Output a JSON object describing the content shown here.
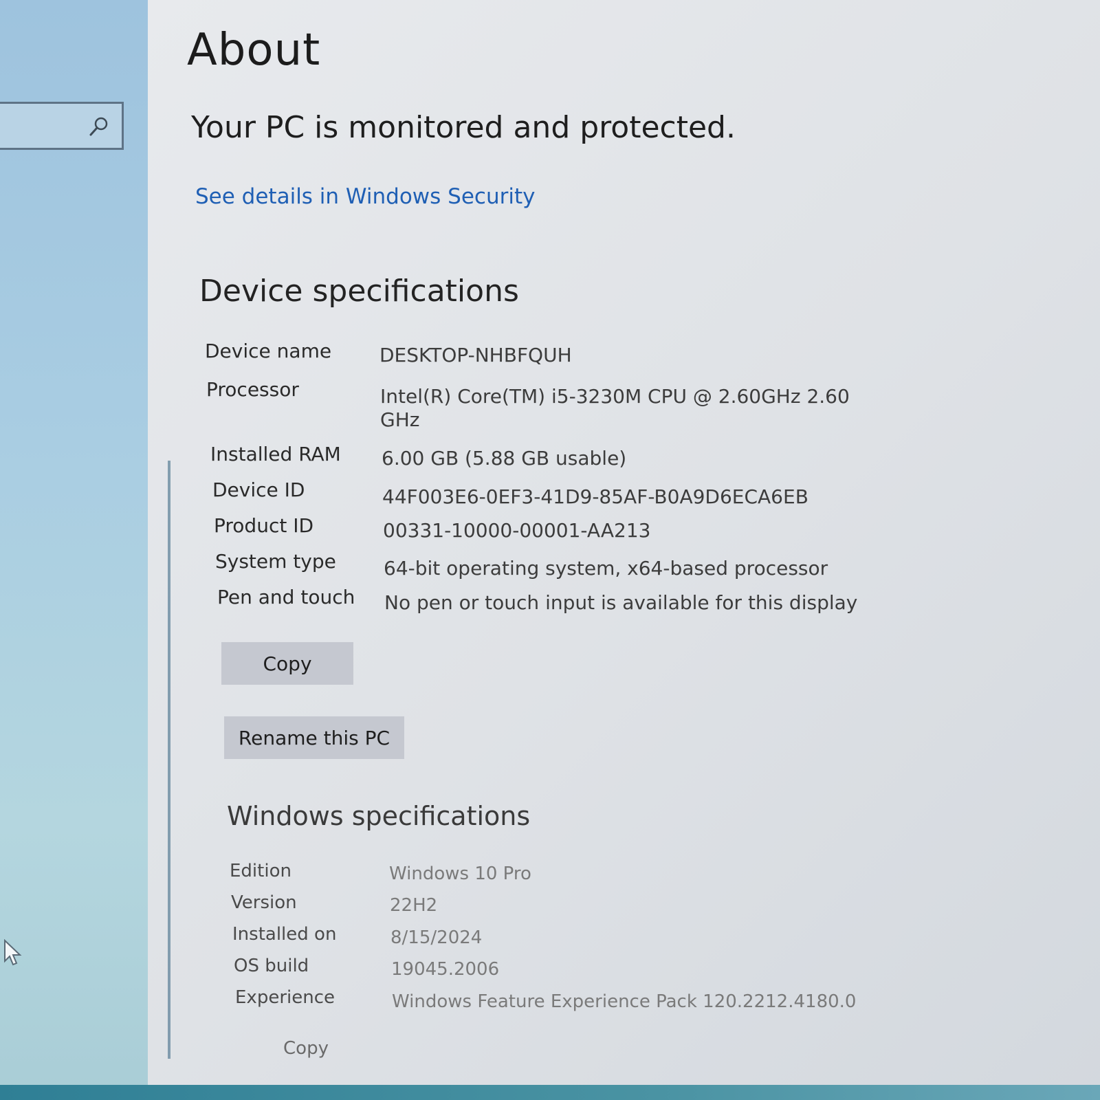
{
  "header": {
    "title": "About"
  },
  "security": {
    "status": "Your PC is monitored and protected.",
    "link": "See details in Windows Security"
  },
  "device_specs": {
    "title": "Device specifications",
    "rows": [
      {
        "label": "Device name",
        "value": "DESKTOP-NHBFQUH"
      },
      {
        "label": "Processor",
        "value": "Intel(R) Core(TM) i5-3230M CPU @ 2.60GHz   2.60 GHz"
      },
      {
        "label": "Installed RAM",
        "value": "6.00 GB (5.88 GB usable)"
      },
      {
        "label": "Device ID",
        "value": "44F003E6-0EF3-41D9-85AF-B0A9D6ECA6EB"
      },
      {
        "label": "Product ID",
        "value": "00331-10000-00001-AA213"
      },
      {
        "label": "System type",
        "value": "64-bit operating system, x64-based processor"
      },
      {
        "label": "Pen and touch",
        "value": "No pen or touch input is available for this display"
      }
    ],
    "copy_label": "Copy",
    "rename_label": "Rename this PC"
  },
  "windows_specs": {
    "title": "Windows specifications",
    "rows": [
      {
        "label": "Edition",
        "value": "Windows 10 Pro"
      },
      {
        "label": "Version",
        "value": "22H2"
      },
      {
        "label": "Installed on",
        "value": "8/15/2024"
      },
      {
        "label": "OS build",
        "value": "19045.2006"
      },
      {
        "label": "Experience",
        "value": "Windows Feature Experience Pack 120.2212.4180.0"
      }
    ],
    "copy_label": "Copy"
  },
  "icons": {
    "search": "search-icon",
    "cursor": "mouse-pointer-icon"
  },
  "colors": {
    "link": "#1f5fb4",
    "sidebar": "#a9cde2",
    "button": "#c5c8d0"
  }
}
